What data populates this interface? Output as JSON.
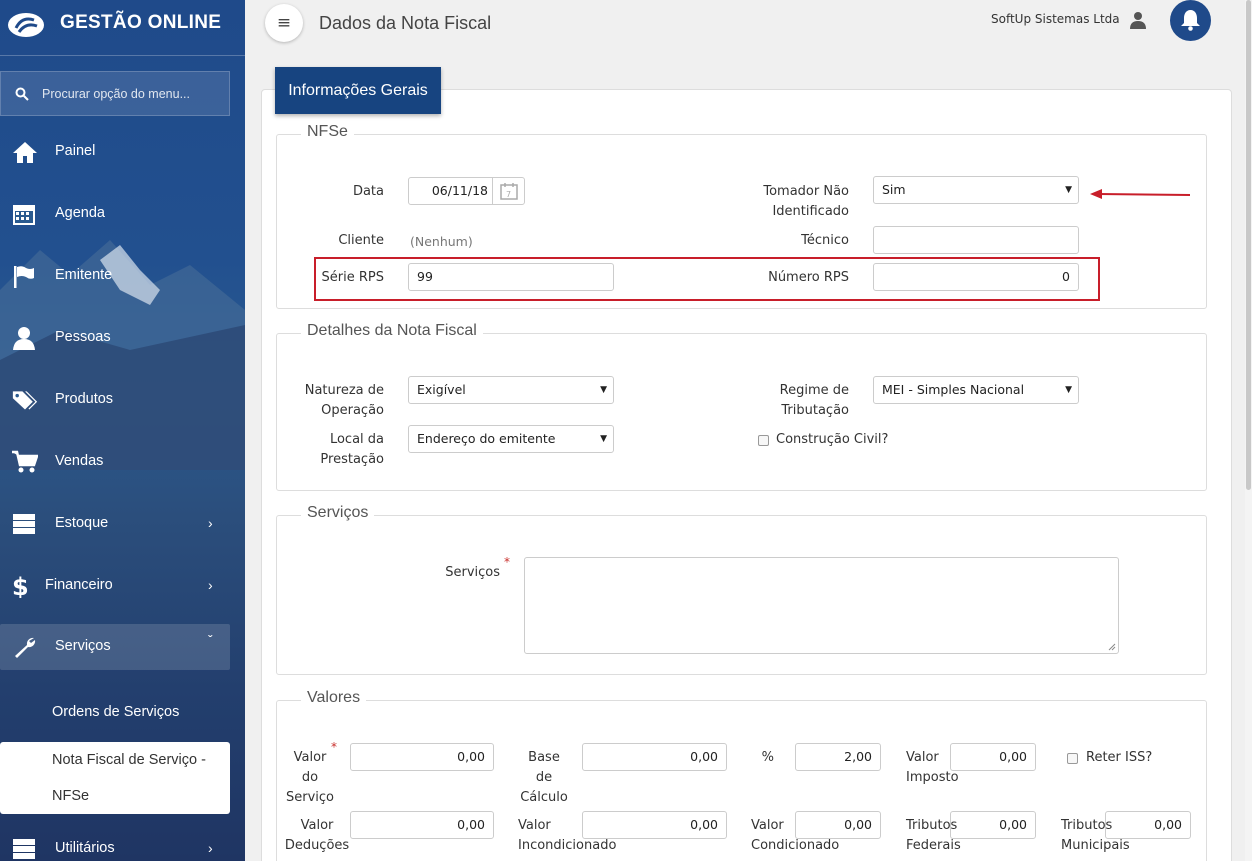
{
  "app": {
    "name": "GESTÃO ONLINE",
    "company": "SoftUp Sistemas Ltda",
    "page_title": "Dados da Nota Fiscal"
  },
  "search": {
    "placeholder": "Procurar opção do menu..."
  },
  "sidebar": {
    "items": [
      {
        "label": "Painel",
        "icon": "home-icon"
      },
      {
        "label": "Agenda",
        "icon": "calendar-icon"
      },
      {
        "label": "Emitente",
        "icon": "flag-icon"
      },
      {
        "label": "Pessoas",
        "icon": "user-icon"
      },
      {
        "label": "Produtos",
        "icon": "tags-icon"
      },
      {
        "label": "Vendas",
        "icon": "cart-icon"
      },
      {
        "label": "Estoque",
        "icon": "server-icon"
      },
      {
        "label": "Financeiro",
        "icon": "dollar-icon"
      },
      {
        "label": "Serviços",
        "icon": "wrench-icon"
      },
      {
        "label": "Utilitários",
        "icon": "server-icon"
      }
    ],
    "sub_items": [
      "Ordens de Serviços",
      "Nota Fiscal de Serviço -",
      "NFSe"
    ]
  },
  "tab": {
    "label": "Informações Gerais"
  },
  "nfse": {
    "legend": "NFSe",
    "data_label": "Data",
    "data_value": "06/11/18",
    "tomador_label_1": "Tomador Não",
    "tomador_label_2": "Identificado",
    "tomador_value": "Sim",
    "cliente_label": "Cliente",
    "cliente_value": "(Nenhum)",
    "tecnico_label": "Técnico",
    "tecnico_value": "",
    "serie_label": "Série RPS",
    "serie_value": "99",
    "numero_label": "Número RPS",
    "numero_value": "0"
  },
  "detalhes": {
    "legend": "Detalhes da Nota Fiscal",
    "natureza_label_1": "Natureza de",
    "natureza_label_2": "Operação",
    "natureza_value": "Exigível",
    "regime_label_1": "Regime de",
    "regime_label_2": "Tributação",
    "regime_value": "MEI - Simples Nacional",
    "local_label_1": "Local da",
    "local_label_2": "Prestação",
    "local_value": "Endereço do emitente",
    "construcao_label": "Construção Civil?"
  },
  "servicos": {
    "legend": "Serviços",
    "label": "Serviços",
    "required_mark": "*"
  },
  "valores": {
    "legend": "Valores",
    "valor_servico_label": [
      "Valor",
      "do",
      "Serviço"
    ],
    "valor_servico": "0,00",
    "base_calculo_label": [
      "Base",
      "de",
      "Cálculo"
    ],
    "base_calculo": "0,00",
    "percent_label": "%",
    "percent": "2,00",
    "valor_imposto_label": [
      "Valor",
      "Imposto"
    ],
    "valor_imposto": "0,00",
    "reter_iss_label": "Reter ISS?",
    "valor_deducoes_label": [
      "Valor",
      "Deduções"
    ],
    "valor_deducoes": "0,00",
    "valor_incond_label": [
      "Valor",
      "Incondicionado"
    ],
    "valor_incond": "0,00",
    "valor_cond_label": [
      "Valor",
      "Condicionado"
    ],
    "valor_cond": "0,00",
    "trib_fed_label": [
      "Tributos",
      "Federais"
    ],
    "trib_fed": "0,00",
    "trib_mun_label": [
      "Tributos",
      "Municipais"
    ],
    "trib_mun": "0,00"
  },
  "colors": {
    "sidebar": "#1f4a8a",
    "tab": "#174480",
    "highlight": "#c81e2a"
  }
}
